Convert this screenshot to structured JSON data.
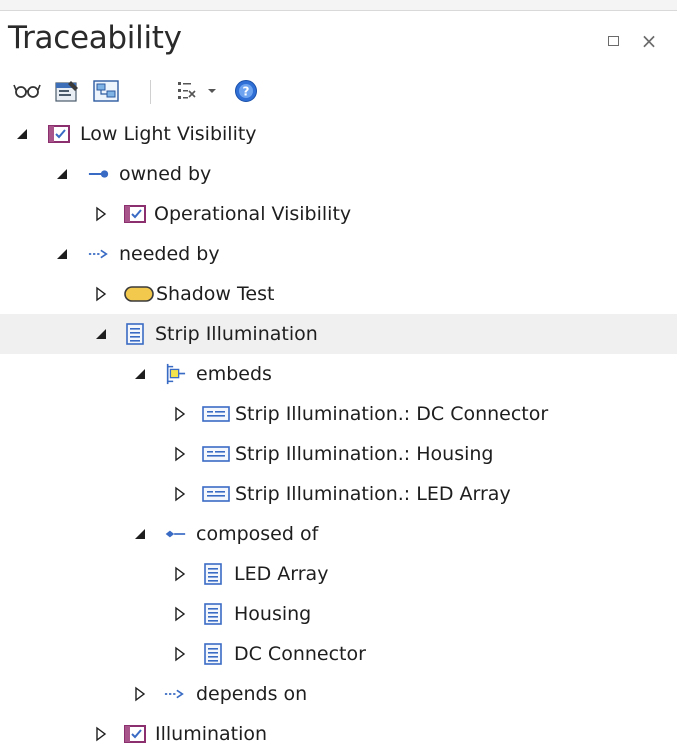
{
  "window": {
    "title": "Traceability",
    "close_glyph": "×"
  },
  "toolbar": {
    "buttons": [
      {
        "icon": "glasses-icon"
      },
      {
        "icon": "properties-icon"
      },
      {
        "icon": "diagram-icon"
      },
      {
        "icon": "filter-list-icon"
      },
      {
        "icon": "dropdown-arrow-icon"
      },
      {
        "icon": "help-icon"
      }
    ]
  },
  "tree": {
    "nodes": [
      {
        "label": "Low Light Visibility",
        "icon": "requirement-icon",
        "expanded": true
      },
      {
        "label": "owned by",
        "icon": "ownership-connector-icon",
        "expanded": true
      },
      {
        "label": "Operational Visibility",
        "icon": "requirement-icon",
        "expanded": false
      },
      {
        "label": "needed by",
        "icon": "dependency-connector-icon",
        "expanded": true
      },
      {
        "label": "Shadow Test",
        "icon": "test-case-icon",
        "expanded": false
      },
      {
        "label": "Strip Illumination",
        "icon": "block-icon",
        "expanded": true,
        "selected": true
      },
      {
        "label": "embeds",
        "icon": "embedding-connector-icon",
        "expanded": true
      },
      {
        "label": "Strip Illumination.: DC Connector",
        "icon": "part-icon",
        "expanded": false
      },
      {
        "label": "Strip Illumination.: Housing",
        "icon": "part-icon",
        "expanded": false
      },
      {
        "label": "Strip Illumination.: LED Array",
        "icon": "part-icon",
        "expanded": false
      },
      {
        "label": "composed of",
        "icon": "composition-connector-icon",
        "expanded": true
      },
      {
        "label": "LED Array",
        "icon": "block-icon",
        "expanded": false
      },
      {
        "label": "Housing",
        "icon": "block-icon",
        "expanded": false
      },
      {
        "label": "DC Connector",
        "icon": "block-icon",
        "expanded": false
      },
      {
        "label": "depends on",
        "icon": "dependency-connector-icon",
        "expanded": false
      },
      {
        "label": "Illumination",
        "icon": "requirement-icon",
        "expanded": false
      }
    ]
  },
  "colors": {
    "requirement_border": "#8c2f6e",
    "connector_blue": "#3a6bc4",
    "test_yellow": "#f2c94c",
    "selection_bg": "#f0f0f0",
    "help_blue": "#2f6fd6"
  }
}
